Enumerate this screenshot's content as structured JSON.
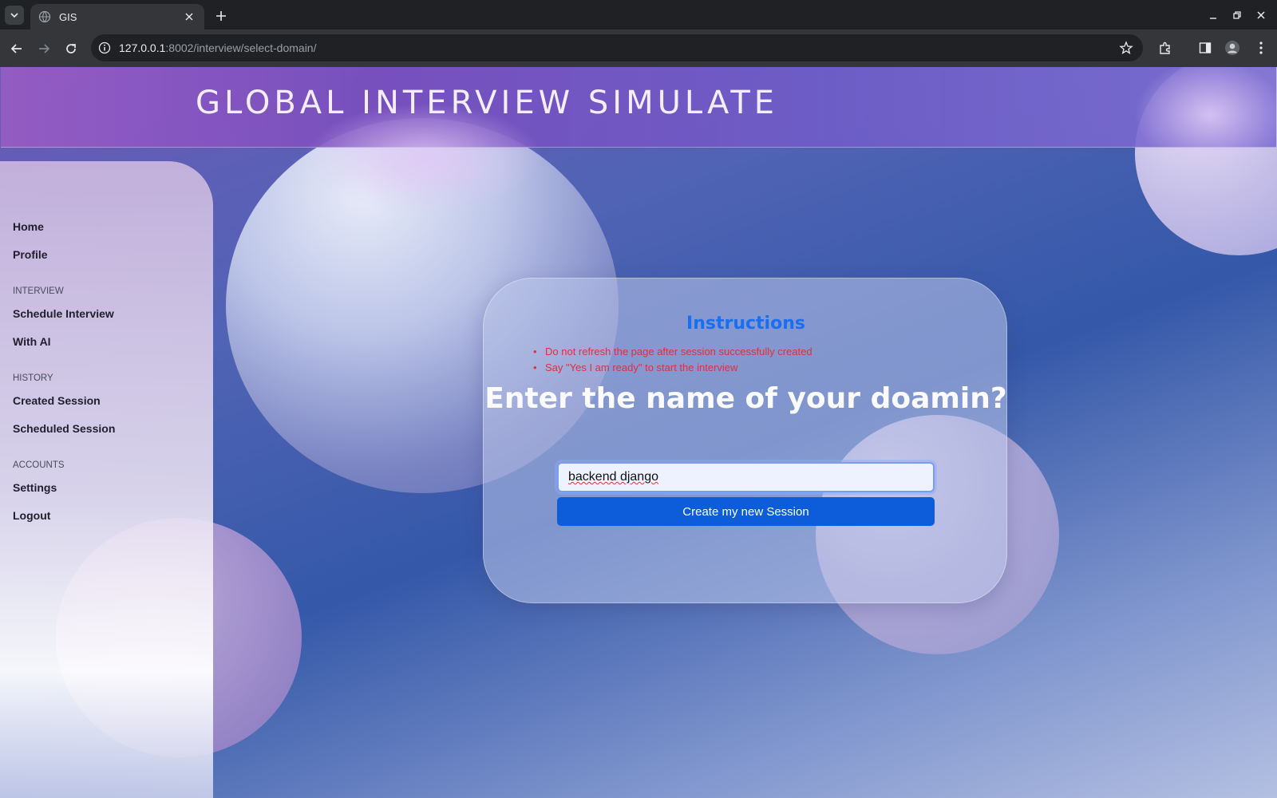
{
  "browser": {
    "tab_title": "GIS",
    "url_host": "127.0.0.1",
    "url_rest": ":8002/interview/select-domain/"
  },
  "header": {
    "title": "GLOBAL INTERVIEW SIMULATE"
  },
  "sidebar": {
    "items": [
      {
        "label": "Home"
      },
      {
        "label": "Profile"
      },
      {
        "section": "INTERVIEW"
      },
      {
        "label": "Schedule Interview"
      },
      {
        "label": "With AI"
      },
      {
        "section": "HISTORY"
      },
      {
        "label": "Created Session"
      },
      {
        "label": "Scheduled Session"
      },
      {
        "section": "ACCOUNTS"
      },
      {
        "label": "Settings"
      },
      {
        "label": "Logout"
      }
    ]
  },
  "card": {
    "instructions_title": "Instructions",
    "instructions": [
      "Do not refresh the page after session successfully created",
      "Say \"Yes I am ready\" to start the interview"
    ],
    "question": "Enter the name of your doamin?",
    "domain_value": "backend django",
    "button_label": "Create my new Session"
  },
  "colors": {
    "accent_blue": "#0d5ddb",
    "instructions_title": "#1a6ff0",
    "instruction_text": "#e0303a"
  }
}
